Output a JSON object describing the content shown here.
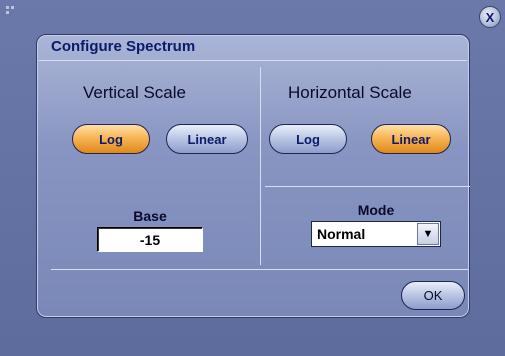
{
  "window": {
    "close_label": "X"
  },
  "dialog": {
    "title": "Configure Spectrum",
    "vertical": {
      "heading": "Vertical Scale",
      "log_label": "Log",
      "linear_label": "Linear",
      "selected": "Log",
      "base_label": "Base",
      "base_value": "-15"
    },
    "horizontal": {
      "heading": "Horizontal Scale",
      "log_label": "Log",
      "linear_label": "Linear",
      "selected": "Linear",
      "mode_label": "Mode",
      "mode_value": "Normal",
      "mode_arrow": "▼"
    },
    "ok_label": "OK"
  },
  "colors": {
    "selected": "#f8b558",
    "unselected": "#b8c4e2",
    "title": "#0b1a6a"
  }
}
